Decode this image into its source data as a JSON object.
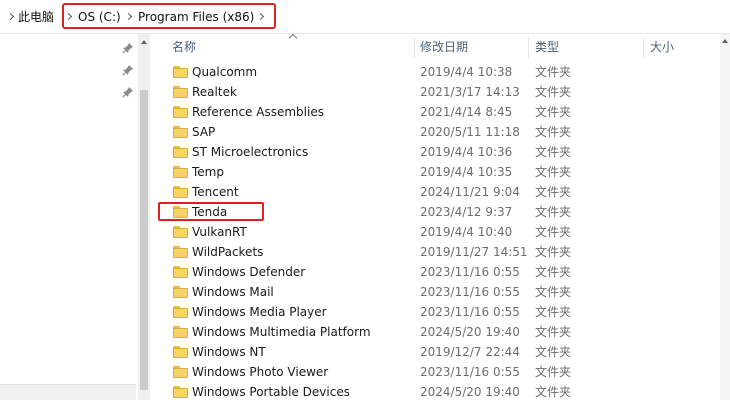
{
  "breadcrumb": {
    "items": [
      "此电脑",
      "OS (C:)",
      "Program Files (x86)"
    ]
  },
  "columns": {
    "name": "名称",
    "date": "修改日期",
    "type": "类型",
    "size": "大小"
  },
  "files": [
    {
      "name": "Qualcomm",
      "date": "2019/4/4 10:38",
      "type": "文件夹"
    },
    {
      "name": "Realtek",
      "date": "2021/3/17 14:13",
      "type": "文件夹"
    },
    {
      "name": "Reference Assemblies",
      "date": "2021/4/14 8:45",
      "type": "文件夹"
    },
    {
      "name": "SAP",
      "date": "2020/5/11 11:18",
      "type": "文件夹"
    },
    {
      "name": "ST Microelectronics",
      "date": "2019/4/4 10:36",
      "type": "文件夹"
    },
    {
      "name": "Temp",
      "date": "2019/4/4 10:35",
      "type": "文件夹"
    },
    {
      "name": "Tencent",
      "date": "2024/11/21 9:04",
      "type": "文件夹"
    },
    {
      "name": "Tenda",
      "date": "2023/4/12 9:37",
      "type": "文件夹"
    },
    {
      "name": "VulkanRT",
      "date": "2019/4/4 10:40",
      "type": "文件夹"
    },
    {
      "name": "WildPackets",
      "date": "2019/11/27 14:51",
      "type": "文件夹"
    },
    {
      "name": "Windows Defender",
      "date": "2023/11/16 0:55",
      "type": "文件夹"
    },
    {
      "name": "Windows Mail",
      "date": "2023/11/16 0:55",
      "type": "文件夹"
    },
    {
      "name": "Windows Media Player",
      "date": "2023/11/16 0:55",
      "type": "文件夹"
    },
    {
      "name": "Windows Multimedia Platform",
      "date": "2024/5/20 19:40",
      "type": "文件夹"
    },
    {
      "name": "Windows NT",
      "date": "2019/12/7 22:44",
      "type": "文件夹"
    },
    {
      "name": "Windows Photo Viewer",
      "date": "2023/11/16 0:55",
      "type": "文件夹"
    },
    {
      "name": "Windows Portable Devices",
      "date": "2024/5/20 19:40",
      "type": "文件夹"
    }
  ]
}
